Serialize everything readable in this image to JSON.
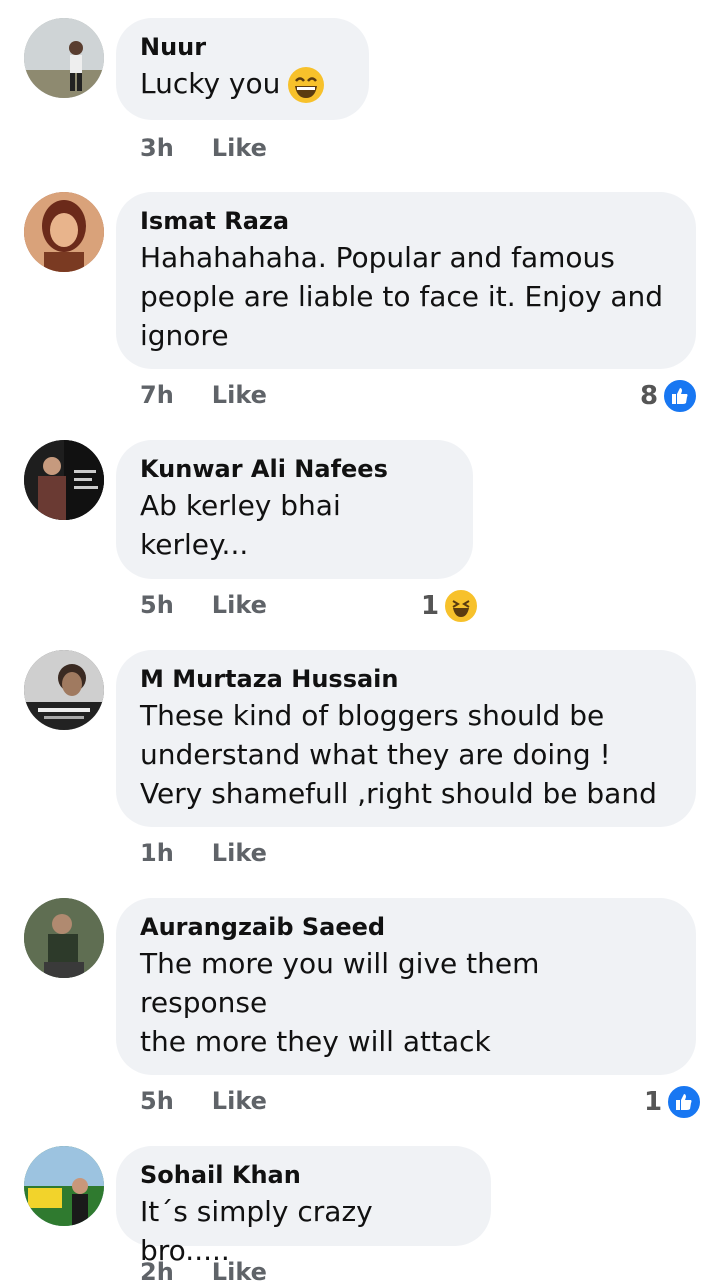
{
  "comments": [
    {
      "author": "Nuur",
      "text": "Lucky you",
      "time": "3h",
      "like_label": "Like",
      "reaction_count": ""
    },
    {
      "author": "Ismat Raza",
      "text": "Hahahahaha. Popular and famous\npeople are liable to face it. Enjoy and\nignore",
      "time": "7h",
      "like_label": "Like",
      "reaction_count": "8"
    },
    {
      "author": "Kunwar Ali Nafees",
      "text": "Ab kerley bhai kerley...",
      "time": "5h",
      "like_label": "Like",
      "reaction_count": "1"
    },
    {
      "author": "M Murtaza Hussain",
      "text": "These kind of bloggers should be\nunderstand what they are doing !\nVery shamefull  ,right should be band",
      "time": "1h",
      "like_label": "Like",
      "reaction_count": ""
    },
    {
      "author": "Aurangzaib Saeed",
      "text": "The more you will give them response\nthe more they will attack",
      "time": "5h",
      "like_label": "Like",
      "reaction_count": "1"
    },
    {
      "author": "Sohail Khan",
      "text": "It´s simply crazy bro.....",
      "time": "2h",
      "like_label": "Like",
      "reaction_count": ""
    }
  ],
  "avatar_colors": [
    "#8a8a7a",
    "#a0522d",
    "#2b2b2b",
    "#3a3a3a",
    "#4a5a48",
    "#3d7a3a"
  ],
  "accent": "#1877f2",
  "bubble_bg": "#f0f2f5"
}
